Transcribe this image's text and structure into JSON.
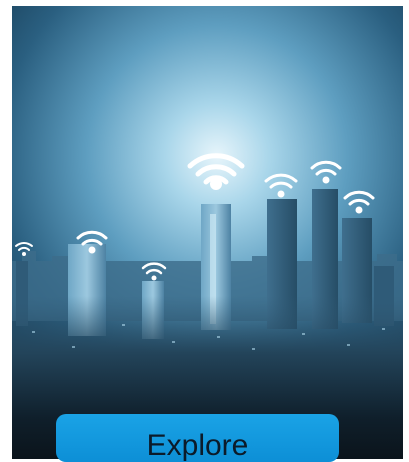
{
  "hero": {
    "image_description_icon": "city-skyline-wifi",
    "colors": {
      "sky_glow": "#cfe8f4",
      "sky_dark": "#0f2d43",
      "wifi": "#ffffff",
      "night": "#0b141b"
    }
  },
  "cta": {
    "label": "Explore"
  }
}
